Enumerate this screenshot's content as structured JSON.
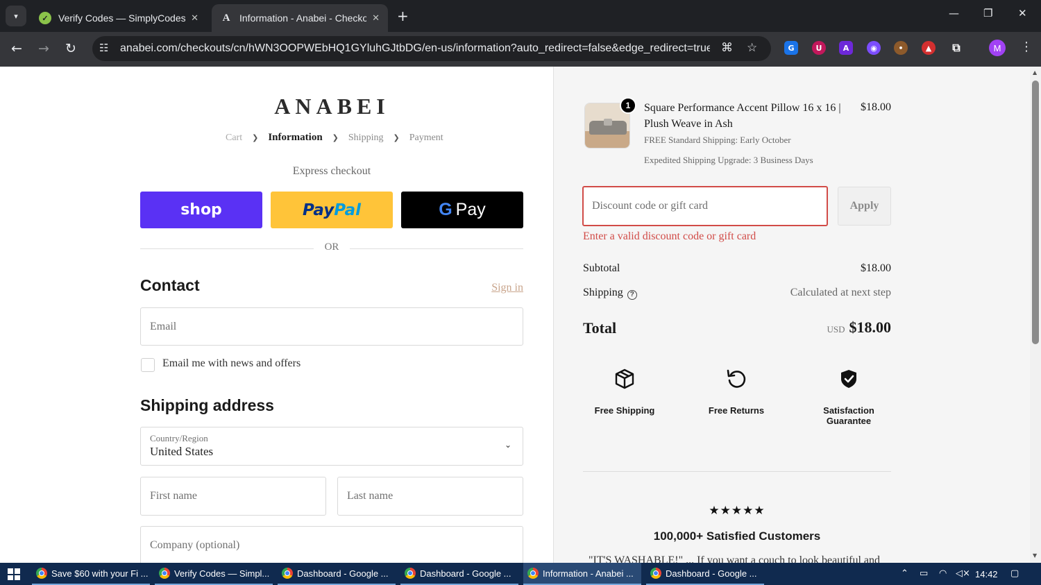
{
  "browser": {
    "tabs": [
      {
        "title": "Verify Codes — SimplyCodes"
      },
      {
        "title": "Information - Anabei - Checkout"
      }
    ],
    "url": "anabei.com/checkouts/cn/hWN3OOPWEbHQ1GYluhGJtbDG/en-us/information?auto_redirect=false&edge_redirect=true&s...",
    "profile_initial": "M"
  },
  "checkout": {
    "logo": "ANABEI",
    "breadcrumb": {
      "cart": "Cart",
      "information": "Information",
      "shipping": "Shipping",
      "payment": "Payment"
    },
    "express_label": "Express checkout",
    "pay_buttons": {
      "shop": "shop",
      "paypal_a": "Pay",
      "paypal_b": "Pal",
      "gpay_g": "G",
      "gpay": "Pay"
    },
    "or_label": "OR",
    "contact": {
      "heading": "Contact",
      "signin": "Sign in",
      "email_placeholder": "Email",
      "newsletter_label": "Email me with news and offers",
      "newsletter_checked": false
    },
    "shipping_address": {
      "heading": "Shipping address",
      "country_label": "Country/Region",
      "country_value": "United States",
      "first_name_placeholder": "First name",
      "last_name_placeholder": "Last name",
      "company_placeholder": "Company (optional)"
    }
  },
  "order_summary": {
    "item": {
      "quantity": "1",
      "name": "Square Performance Accent Pillow 16 x 16 | Plush Weave in Ash",
      "price": "$18.00",
      "note1": "FREE Standard Shipping: Early October",
      "note2": "Expedited Shipping Upgrade: 3 Business Days"
    },
    "discount_placeholder": "Discount code or gift card",
    "apply_label": "Apply",
    "discount_error": "Enter a valid discount code or gift card",
    "subtotal_label": "Subtotal",
    "subtotal_value": "$18.00",
    "shipping_label": "Shipping",
    "shipping_value": "Calculated at next step",
    "total_label": "Total",
    "total_currency": "USD",
    "total_value": "$18.00",
    "trust": [
      {
        "label": "Free Shipping",
        "icon": "box-icon"
      },
      {
        "label": "Free Returns",
        "icon": "return-icon"
      },
      {
        "label": "Satisfaction Guarantee",
        "icon": "shield-check-icon"
      }
    ],
    "stars": "★★★★★",
    "satisfied": "100,000+ Satisfied Customers",
    "quote": "\"IT'S WASHABLE!\" ... If you want a couch to look beautiful and"
  },
  "taskbar": {
    "items": [
      {
        "label": "Save $60 with your Fi ..."
      },
      {
        "label": "Verify Codes — Simpl..."
      },
      {
        "label": "Dashboard - Google ..."
      },
      {
        "label": "Dashboard - Google ..."
      },
      {
        "label": "Information - Anabei ..."
      },
      {
        "label": "Dashboard - Google ..."
      }
    ],
    "time": "14:42"
  },
  "colors": {
    "shop_purple": "#5a31f4",
    "paypal_yellow": "#ffc439",
    "error_red": "#d14b47",
    "signin_link": "#c9a58c"
  }
}
